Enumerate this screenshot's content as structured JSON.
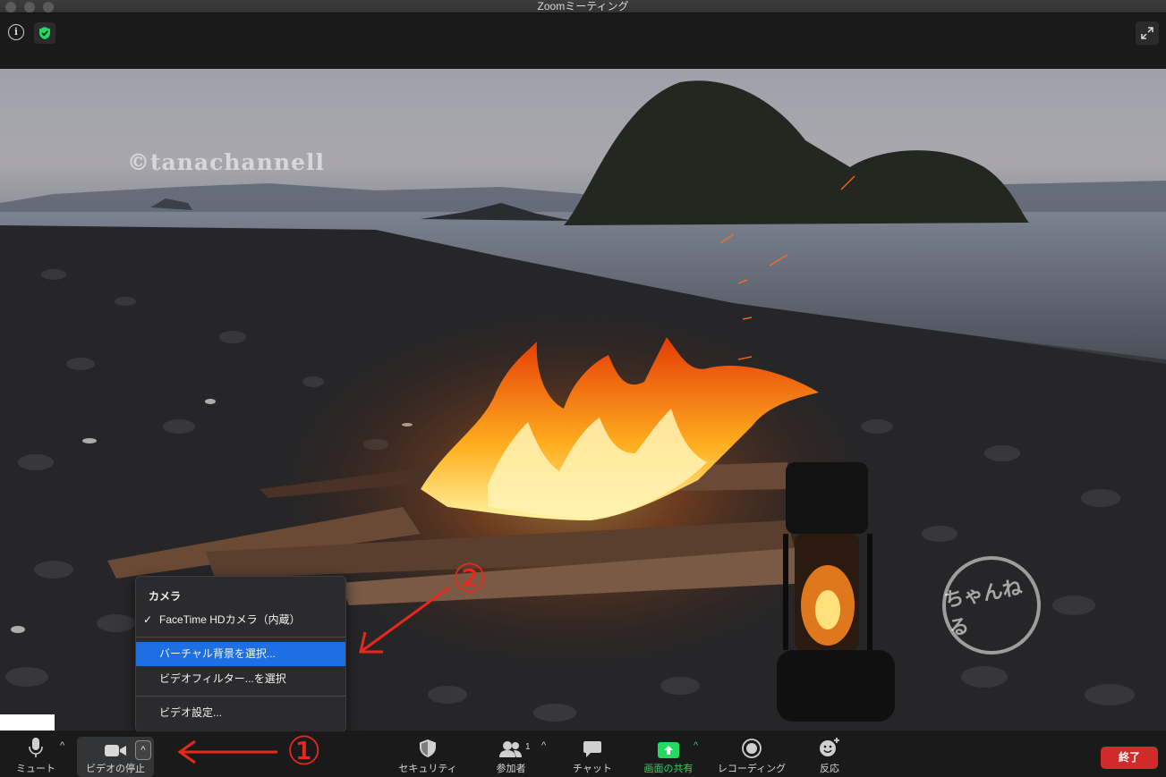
{
  "window": {
    "title": "Zoomミーティング"
  },
  "video": {
    "watermark": "©tanachannell",
    "logo_text": "ちゃんねる"
  },
  "annotations": {
    "step1": "①",
    "step2": "②"
  },
  "menu": {
    "header": "カメラ",
    "items": [
      {
        "label": "FaceTime HDカメラ（内蔵）",
        "checked": true
      },
      {
        "label": "バーチャル背景を選択...",
        "selected": true
      },
      {
        "label": "ビデオフィルター...を選択"
      },
      {
        "label": "ビデオ設定..."
      }
    ],
    "check_mark": "✓"
  },
  "toolbar": {
    "mute": "ミュート",
    "video_stop": "ビデオの停止",
    "security": "セキュリティ",
    "participants": "参加者",
    "participants_count": "1",
    "chat": "チャット",
    "share_screen": "画面の共有",
    "recording": "レコーディング",
    "reactions": "反応",
    "end": "終了",
    "caret": "^"
  },
  "colors": {
    "accent_blue": "#1d6fe3",
    "share_green": "#23d962",
    "end_red": "#d12a2a",
    "annotation_red": "#e8281c"
  }
}
